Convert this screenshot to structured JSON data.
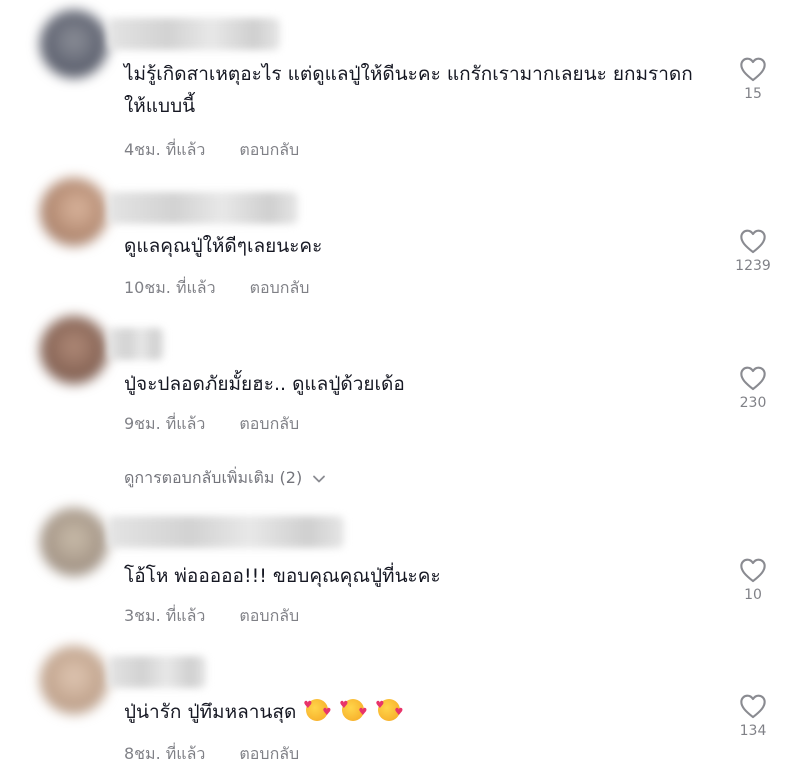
{
  "comments": [
    {
      "text": "ไม่รู้เกิดสาเหตุอะไร แต่ดูแลปู่ให้ดีนะคะ แกรักเรามากเลยนะ ยกมราดกให้แบบนี้",
      "time": "4ชม. ที่แล้ว",
      "reply_label": "ตอบกลับ",
      "likes": "15"
    },
    {
      "text": "ดูแลคุณปู่ให้ดีๆเลยนะคะ",
      "time": "10ชม. ที่แล้ว",
      "reply_label": "ตอบกลับ",
      "likes": "1239"
    },
    {
      "text": "ปู่จะปลอดภัยมั้ยฮะ.. ดูแลปู่ด้วยเด้อ",
      "time": "9ชม. ที่แล้ว",
      "reply_label": "ตอบกลับ",
      "likes": "230"
    },
    {
      "text": "โอ้โห พ่อออออ!!! ขอบคุณคุณปู่ที่นะคะ",
      "time": "3ชม. ที่แล้ว",
      "reply_label": "ตอบกลับ",
      "likes": "10"
    },
    {
      "text": "ปู่น่ารัก ปู่ทึมหลานสุด",
      "time": "8ชม. ที่แล้ว",
      "reply_label": "ตอบกลับ",
      "likes": "134"
    }
  ],
  "view_more_replies": "ดูการตอบกลับเพิ่มเติม (2)",
  "icons": {
    "like": "heart-outline-icon",
    "expand": "chevron-down-icon",
    "emoji": "smiling-face-with-hearts-emoji"
  },
  "colors": {
    "text": "#161823",
    "secondary": "#8a8b91",
    "background": "#ffffff"
  }
}
